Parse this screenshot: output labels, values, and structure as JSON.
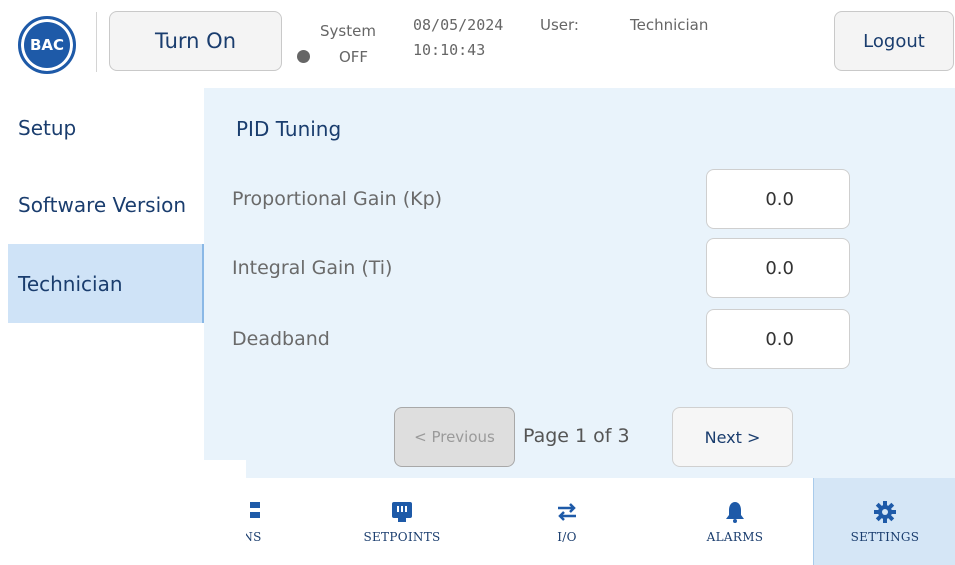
{
  "header": {
    "logo_text": "BAC",
    "turn_on_label": "Turn On",
    "system_label": "System",
    "system_state": "OFF",
    "date": "08/05/2024",
    "time": "10:10:43",
    "user_label": "User:",
    "user_value": "Technician",
    "logout_label": "Logout"
  },
  "sidebar": {
    "items": [
      {
        "label": "Setup"
      },
      {
        "label": "Software Version"
      },
      {
        "label": "Technician",
        "active": true
      }
    ]
  },
  "main": {
    "title": "PID Tuning",
    "rows": [
      {
        "label": "Proportional Gain (Kp)",
        "value": "0.0"
      },
      {
        "label": "Integral Gain (Ti)",
        "value": "0.0"
      },
      {
        "label": "Deadband",
        "value": "0.0"
      }
    ],
    "prev_label": "< Previous",
    "page_indicator": "Page 1 of 3",
    "next_label": "Next >"
  },
  "bottom_nav": {
    "partial_label": "NS",
    "tabs": [
      {
        "label": "SETPOINTS",
        "icon": "setpoints-icon"
      },
      {
        "label": "I/O",
        "icon": "io-icon"
      },
      {
        "label": "ALARMS",
        "icon": "bell-icon"
      },
      {
        "label": "SETTINGS",
        "icon": "gear-icon",
        "active": true
      }
    ]
  },
  "colors": {
    "accent": "#1a3d6e",
    "panel_bg": "#e9f3fb",
    "active_bg": "#cfe3f7"
  }
}
